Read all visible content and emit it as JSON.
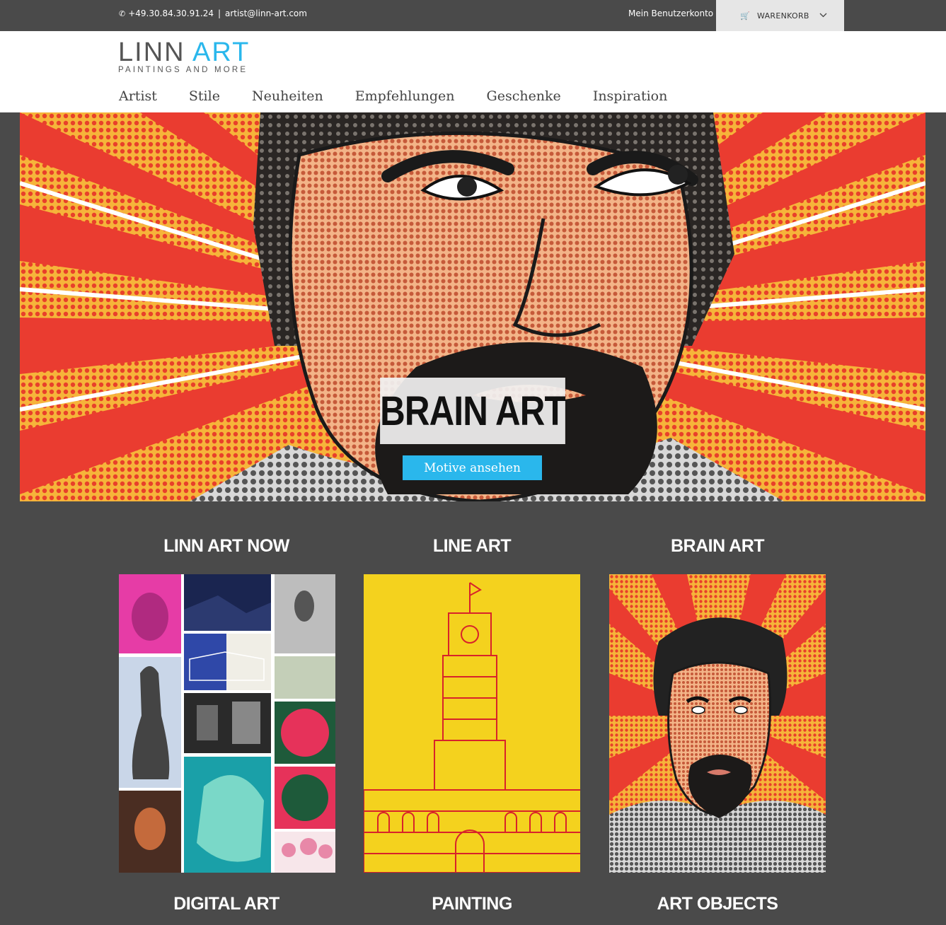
{
  "topbar": {
    "phone": "+49.30.84.30.91.24",
    "separator": "|",
    "email": "artist@linn-art.com",
    "account_label": "Mein Benutzerkonto",
    "cart_label": "WARENKORB"
  },
  "logo": {
    "word1": "LINN",
    "word2": "ART",
    "tagline": "PAINTINGS AND MORE"
  },
  "nav": {
    "items": [
      "Artist",
      "Stile",
      "Neuheiten",
      "Empfehlungen",
      "Geschenke",
      "Inspiration"
    ]
  },
  "hero": {
    "title": "BRAIN ART",
    "button_label": "Motive ansehen"
  },
  "categories": {
    "row1": [
      "LINN ART NOW",
      "LINE ART",
      "BRAIN ART"
    ],
    "row2": [
      "DIGITAL ART",
      "PAINTING",
      "ART OBJECTS"
    ]
  },
  "colors": {
    "accent": "#2ab7ec",
    "background": "#4a4a4a",
    "cart_bg": "#e6e6e6"
  }
}
